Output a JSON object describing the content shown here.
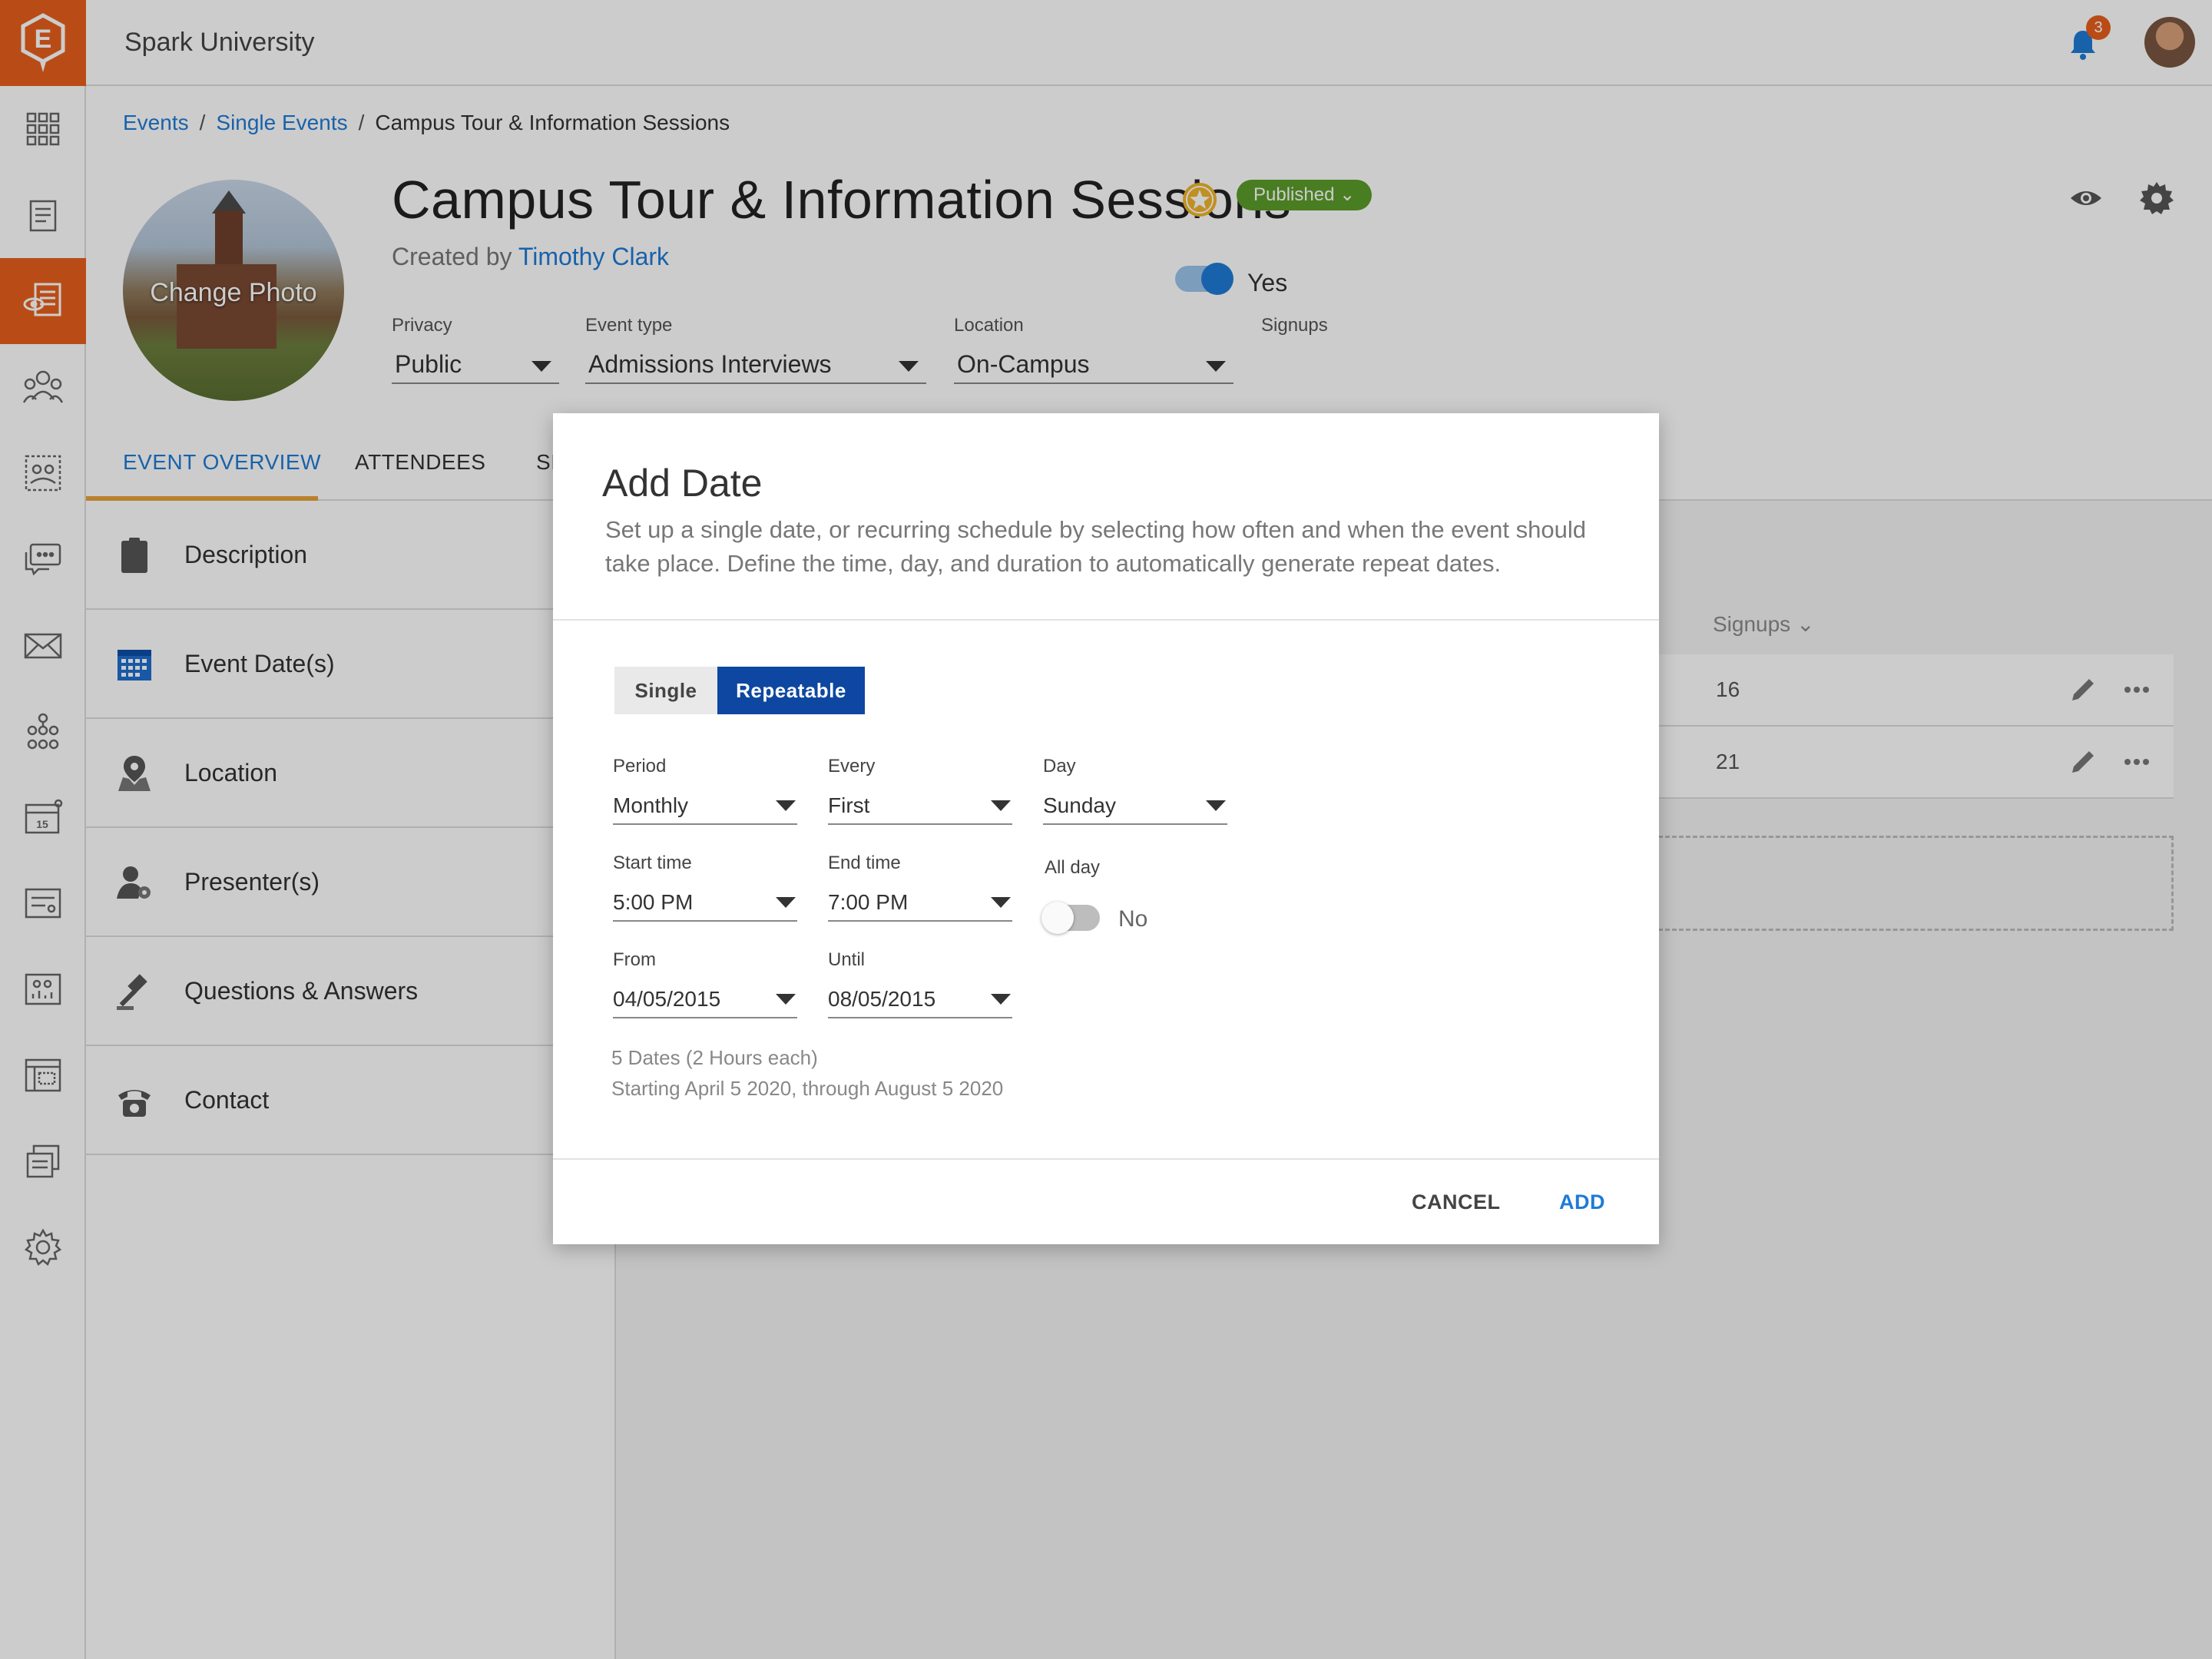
{
  "app": {
    "title": "Spark University",
    "notifications": "3"
  },
  "rail": {
    "icons": [
      "dashboard-grid-icon",
      "report-icon",
      "event-icon",
      "people-icon",
      "groups-icon",
      "chat-icon",
      "mail-icon",
      "org-chart-icon",
      "calendar-icon",
      "form-icon",
      "analytics-icon",
      "page-builder-icon",
      "documents-icon",
      "settings-icon"
    ]
  },
  "breadcrumb": {
    "events": "Events",
    "single_events": "Single Events",
    "current": "Campus Tour & Information Sessions",
    "sep": "/"
  },
  "event": {
    "photo_label": "Change Photo",
    "title": "Campus Tour & Information Sessions",
    "status": "Published ⌄",
    "created_prefix": "Created by ",
    "created_by": "Timothy Clark"
  },
  "fields": {
    "privacy": {
      "label": "Privacy",
      "value": "Public"
    },
    "event_type": {
      "label": "Event type",
      "value": "Admissions Interviews"
    },
    "location": {
      "label": "Location",
      "value": "On-Campus"
    },
    "signups": {
      "label": "Signups",
      "value": "Yes"
    }
  },
  "tabs": [
    "EVENT OVERVIEW",
    "ATTENDEES",
    "SI"
  ],
  "sections": [
    "Description",
    "Event Date(s)",
    "Location",
    "Presenter(s)",
    "Questions & Answers",
    "Contact"
  ],
  "table": {
    "signups_header": "Signups ⌄",
    "rows": [
      "16",
      "21"
    ]
  },
  "modal": {
    "title": "Add Date",
    "description": "Set up a single date, or recurring schedule by selecting how often and when the event should take place. Define the time, day, and duration to automatically generate repeat dates.",
    "seg_single": "Single",
    "seg_repeatable": "Repeatable",
    "period": {
      "label": "Period",
      "value": "Monthly"
    },
    "every": {
      "label": "Every",
      "value": "First"
    },
    "day": {
      "label": "Day",
      "value": "Sunday"
    },
    "start_time": {
      "label": "Start time",
      "value": "5:00 PM"
    },
    "end_time": {
      "label": "End time",
      "value": "7:00 PM"
    },
    "all_day": {
      "label": "All day",
      "value": "No"
    },
    "from": {
      "label": "From",
      "value": "04/05/2015"
    },
    "until": {
      "label": "Until",
      "value": "08/05/2015"
    },
    "summary_line1": "5 Dates (2 Hours each)",
    "summary_line2": "Starting April 5 2020,  through August 5 2020",
    "cancel": "CANCEL",
    "add": "ADD"
  },
  "colors": {
    "accent": "#e8601c",
    "link": "#1e7bd6",
    "primary": "#0d47a1",
    "published": "#5c9d2a"
  }
}
